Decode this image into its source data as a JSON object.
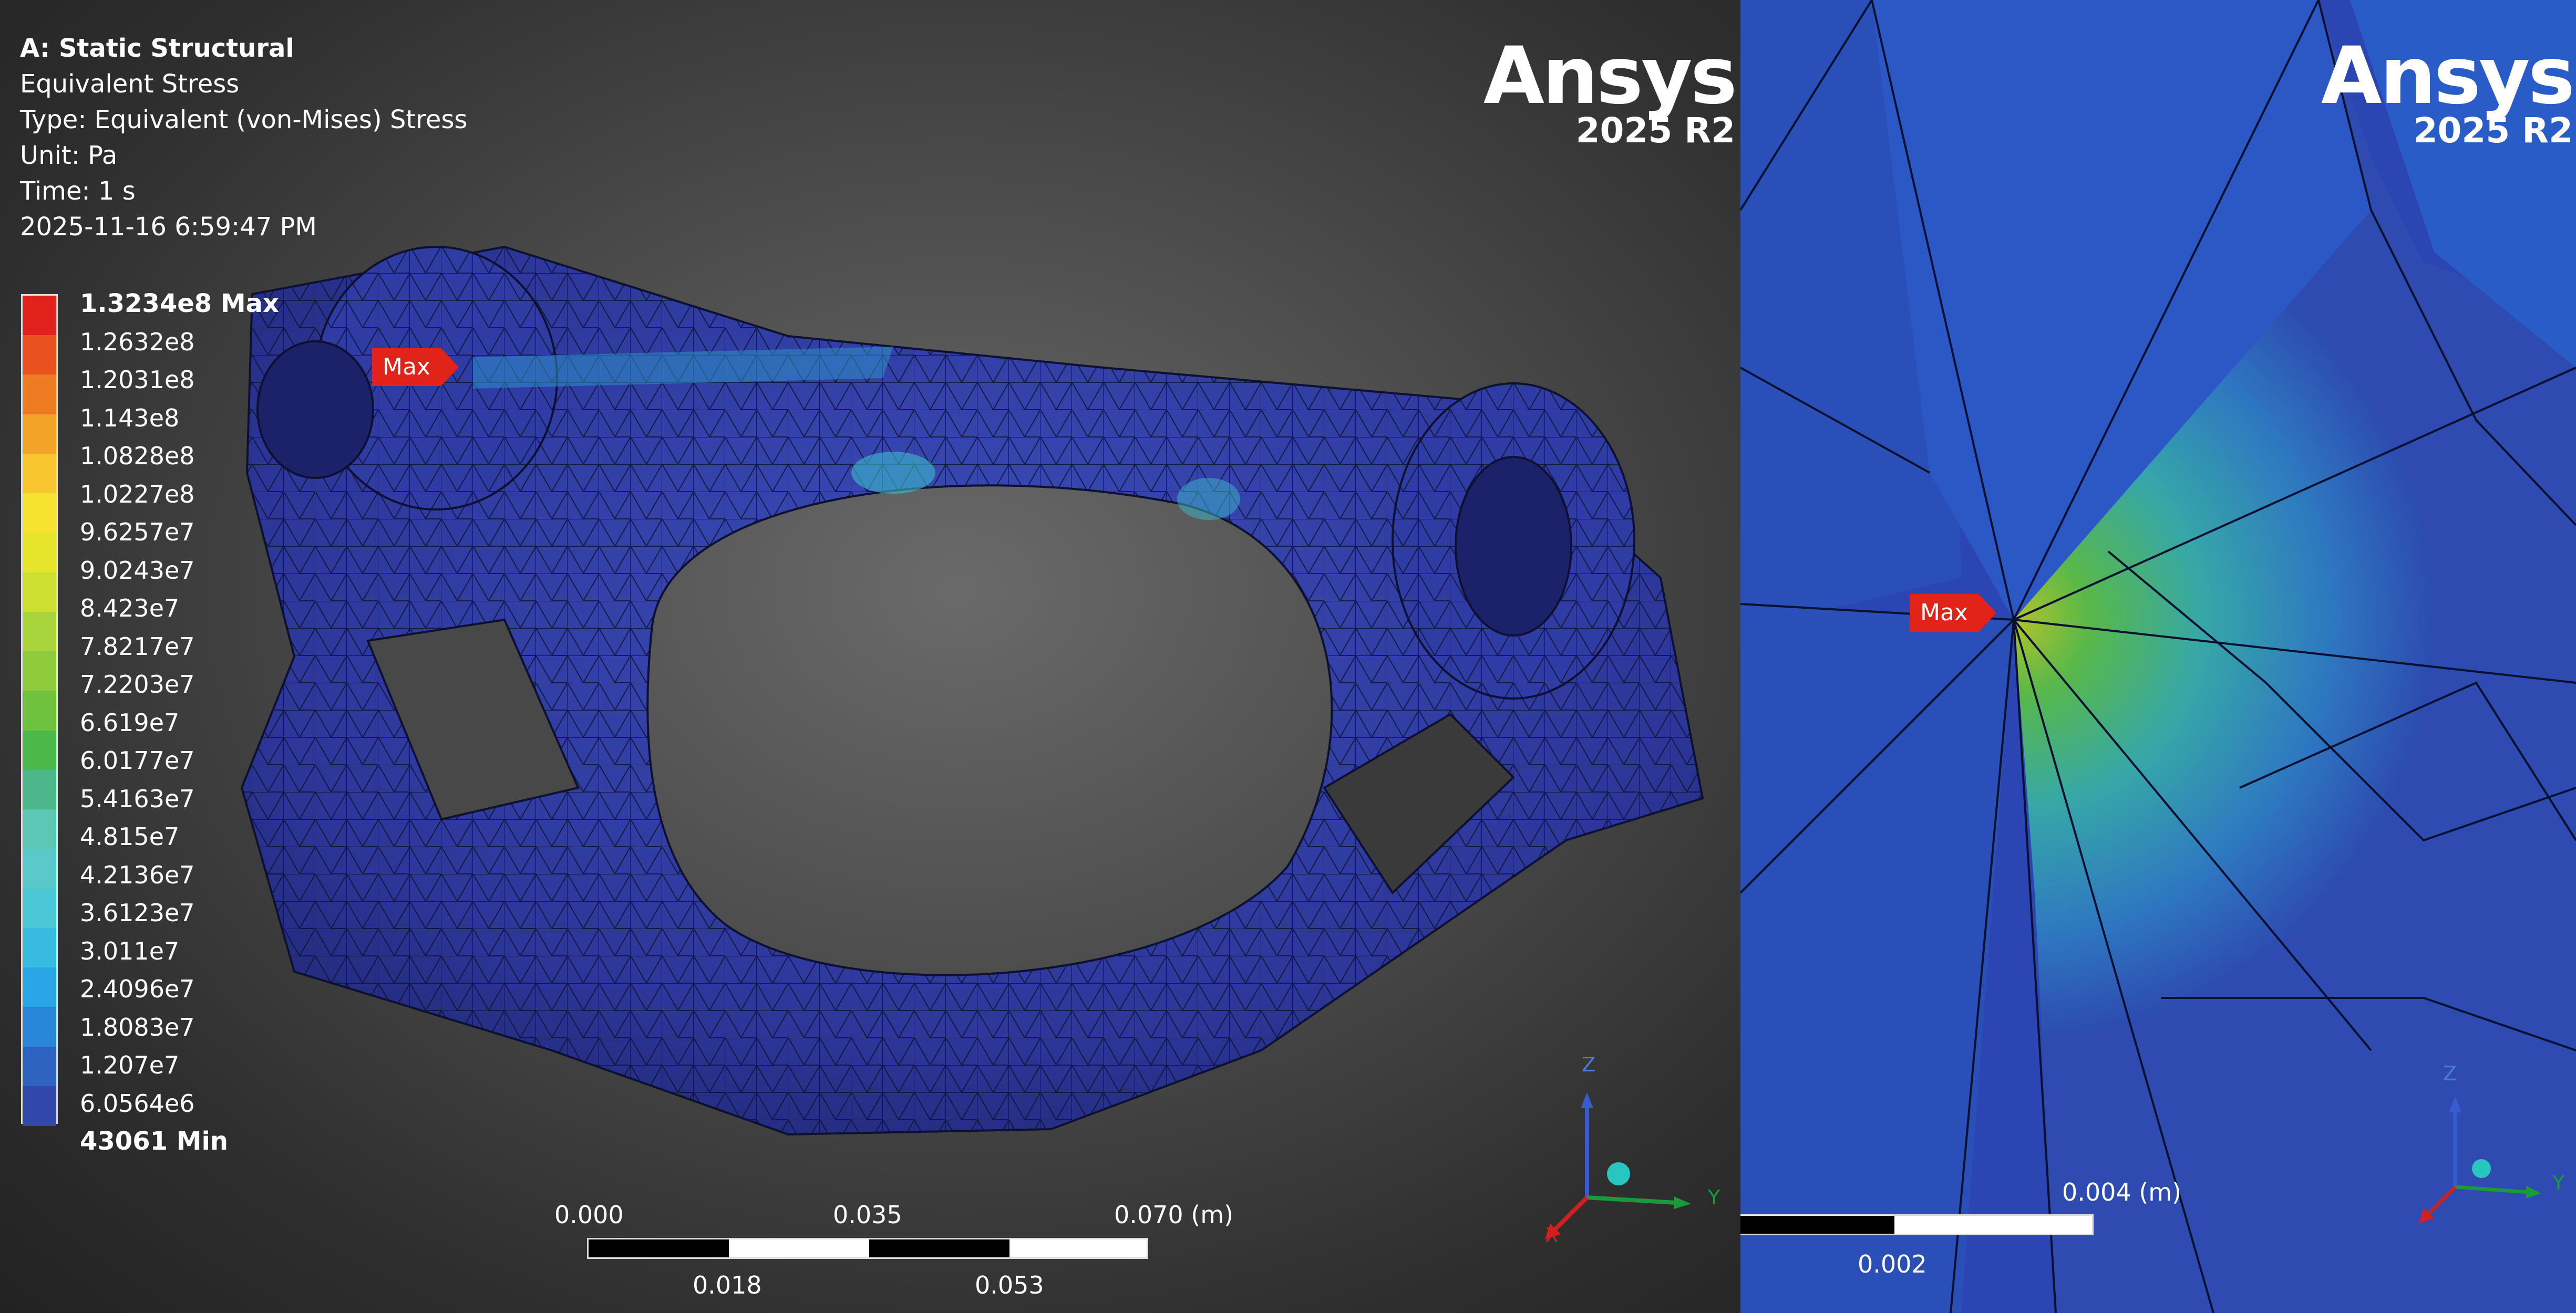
{
  "left_view": {
    "info": {
      "title": "A: Static Structural",
      "result": "Equivalent Stress",
      "type": "Type: Equivalent (von-Mises) Stress",
      "unit": "Unit: Pa",
      "time": "Time: 1 s",
      "timestamp": "2025-11-16 6:59:47 PM"
    },
    "legend": {
      "labels": [
        "1.3234e8 Max",
        "1.2632e8",
        "1.2031e8",
        "1.143e8",
        "1.0828e8",
        "1.0227e8",
        "9.6257e7",
        "9.0243e7",
        "8.423e7",
        "7.8217e7",
        "7.2203e7",
        "6.619e7",
        "6.0177e7",
        "5.4163e7",
        "4.815e7",
        "4.2136e7",
        "3.6123e7",
        "3.011e7",
        "2.4096e7",
        "1.8083e7",
        "1.207e7",
        "6.0564e6",
        "43061 Min"
      ],
      "colors": [
        "#e1211c",
        "#e9521f",
        "#ee7a22",
        "#f2a32a",
        "#f7c52e",
        "#f7e232",
        "#e6e52c",
        "#cbe030",
        "#a9d43c",
        "#8fcb3c",
        "#6fc23e",
        "#4bb84a",
        "#4cb88a",
        "#5bc7b4",
        "#5ac9c9",
        "#4cc7d8",
        "#38bbe0",
        "#2aa6e6",
        "#2a86d8",
        "#2f63c2",
        "#3148aa"
      ]
    },
    "logo": {
      "name": "Ansys",
      "version": "2025 R2"
    },
    "scale": {
      "top_labels": [
        "0.000",
        "0.035",
        "0.070 (m)"
      ],
      "bottom_labels": [
        "0.018",
        "0.053"
      ]
    },
    "max_tag": "Max",
    "triad": {
      "z": "Z",
      "y": "Y",
      "x": "X"
    }
  },
  "right_view": {
    "logo": {
      "name": "Ansys",
      "version": "2025 R2"
    },
    "scale": {
      "top_label": "0.004 (m)",
      "bottom_label": "0.002"
    },
    "max_tag": "Max",
    "triad": {
      "z": "Z",
      "y": "Y"
    }
  },
  "colors": {
    "max_tag": "#e2231a",
    "model_blue": "#2c3a9a"
  }
}
